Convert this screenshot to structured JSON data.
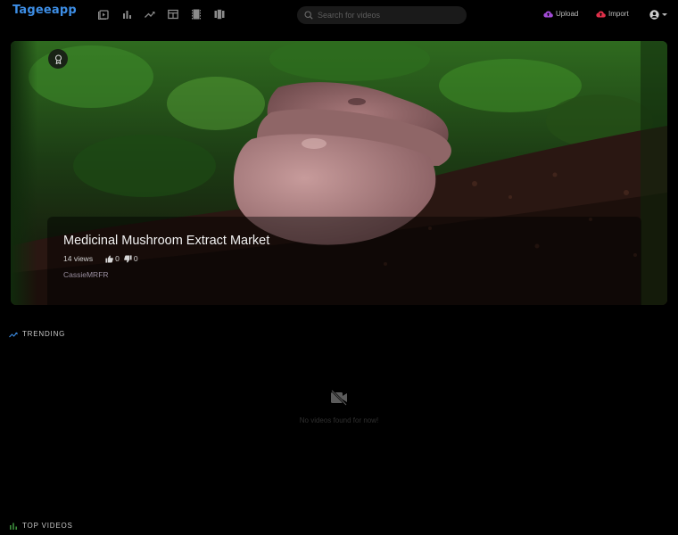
{
  "header": {
    "logo": "Tageeapp",
    "nav_icons": [
      "videos-icon",
      "bar-chart-icon",
      "trending-icon",
      "layout-icon",
      "film-icon",
      "columns-icon"
    ],
    "search_placeholder": "Search for videos",
    "upload_label": "Upload",
    "import_label": "Import",
    "colors": {
      "logo": "#3d8ee6",
      "upload_icon": "#a24bd6",
      "import_icon": "#e0304a"
    }
  },
  "hero": {
    "title": "Medicinal Mushroom Extract Market",
    "views": "14 views",
    "likes": "0",
    "dislikes": "0",
    "author": "CassieMRFR",
    "badge_icon": "award-icon"
  },
  "sections": {
    "trending_label": "TRENDING",
    "trending_empty_text": "No videos found for now!",
    "top_videos_label": "TOP VIDEOS"
  }
}
